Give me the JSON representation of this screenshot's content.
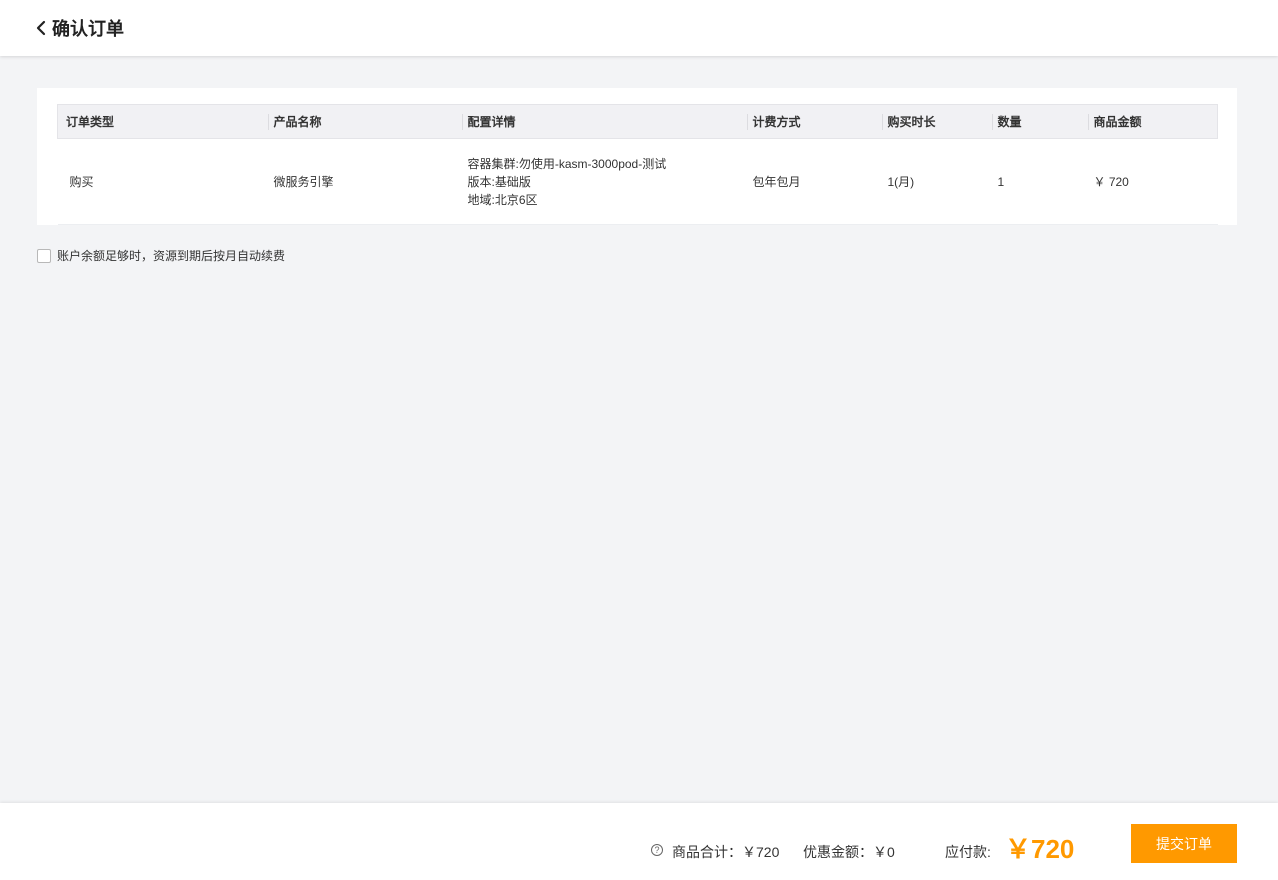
{
  "header": {
    "title": "确认订单"
  },
  "table": {
    "columns": [
      "订单类型",
      "产品名称",
      "配置详情",
      "计费方式",
      "购买时长",
      "数量",
      "商品金额"
    ],
    "row": {
      "order_type": "购买",
      "product_name": "微服务引擎",
      "config": [
        "容器集群:勿使用-kasm-3000pod-测试",
        "版本:基础版",
        "地域:北京6区"
      ],
      "billing": "包年包月",
      "duration": "1(月)",
      "quantity": "1",
      "amount": "￥ 720"
    }
  },
  "auto_renew": {
    "label": "账户余额足够时，资源到期后按月自动续费",
    "checked": false
  },
  "footer": {
    "goods_total": "商品合计：￥720",
    "discount": "优惠金额：￥0",
    "payable_label": "应付款:",
    "payable_value": "￥720",
    "submit_label": "提交订单"
  },
  "colors": {
    "accent": "#ff9900"
  }
}
